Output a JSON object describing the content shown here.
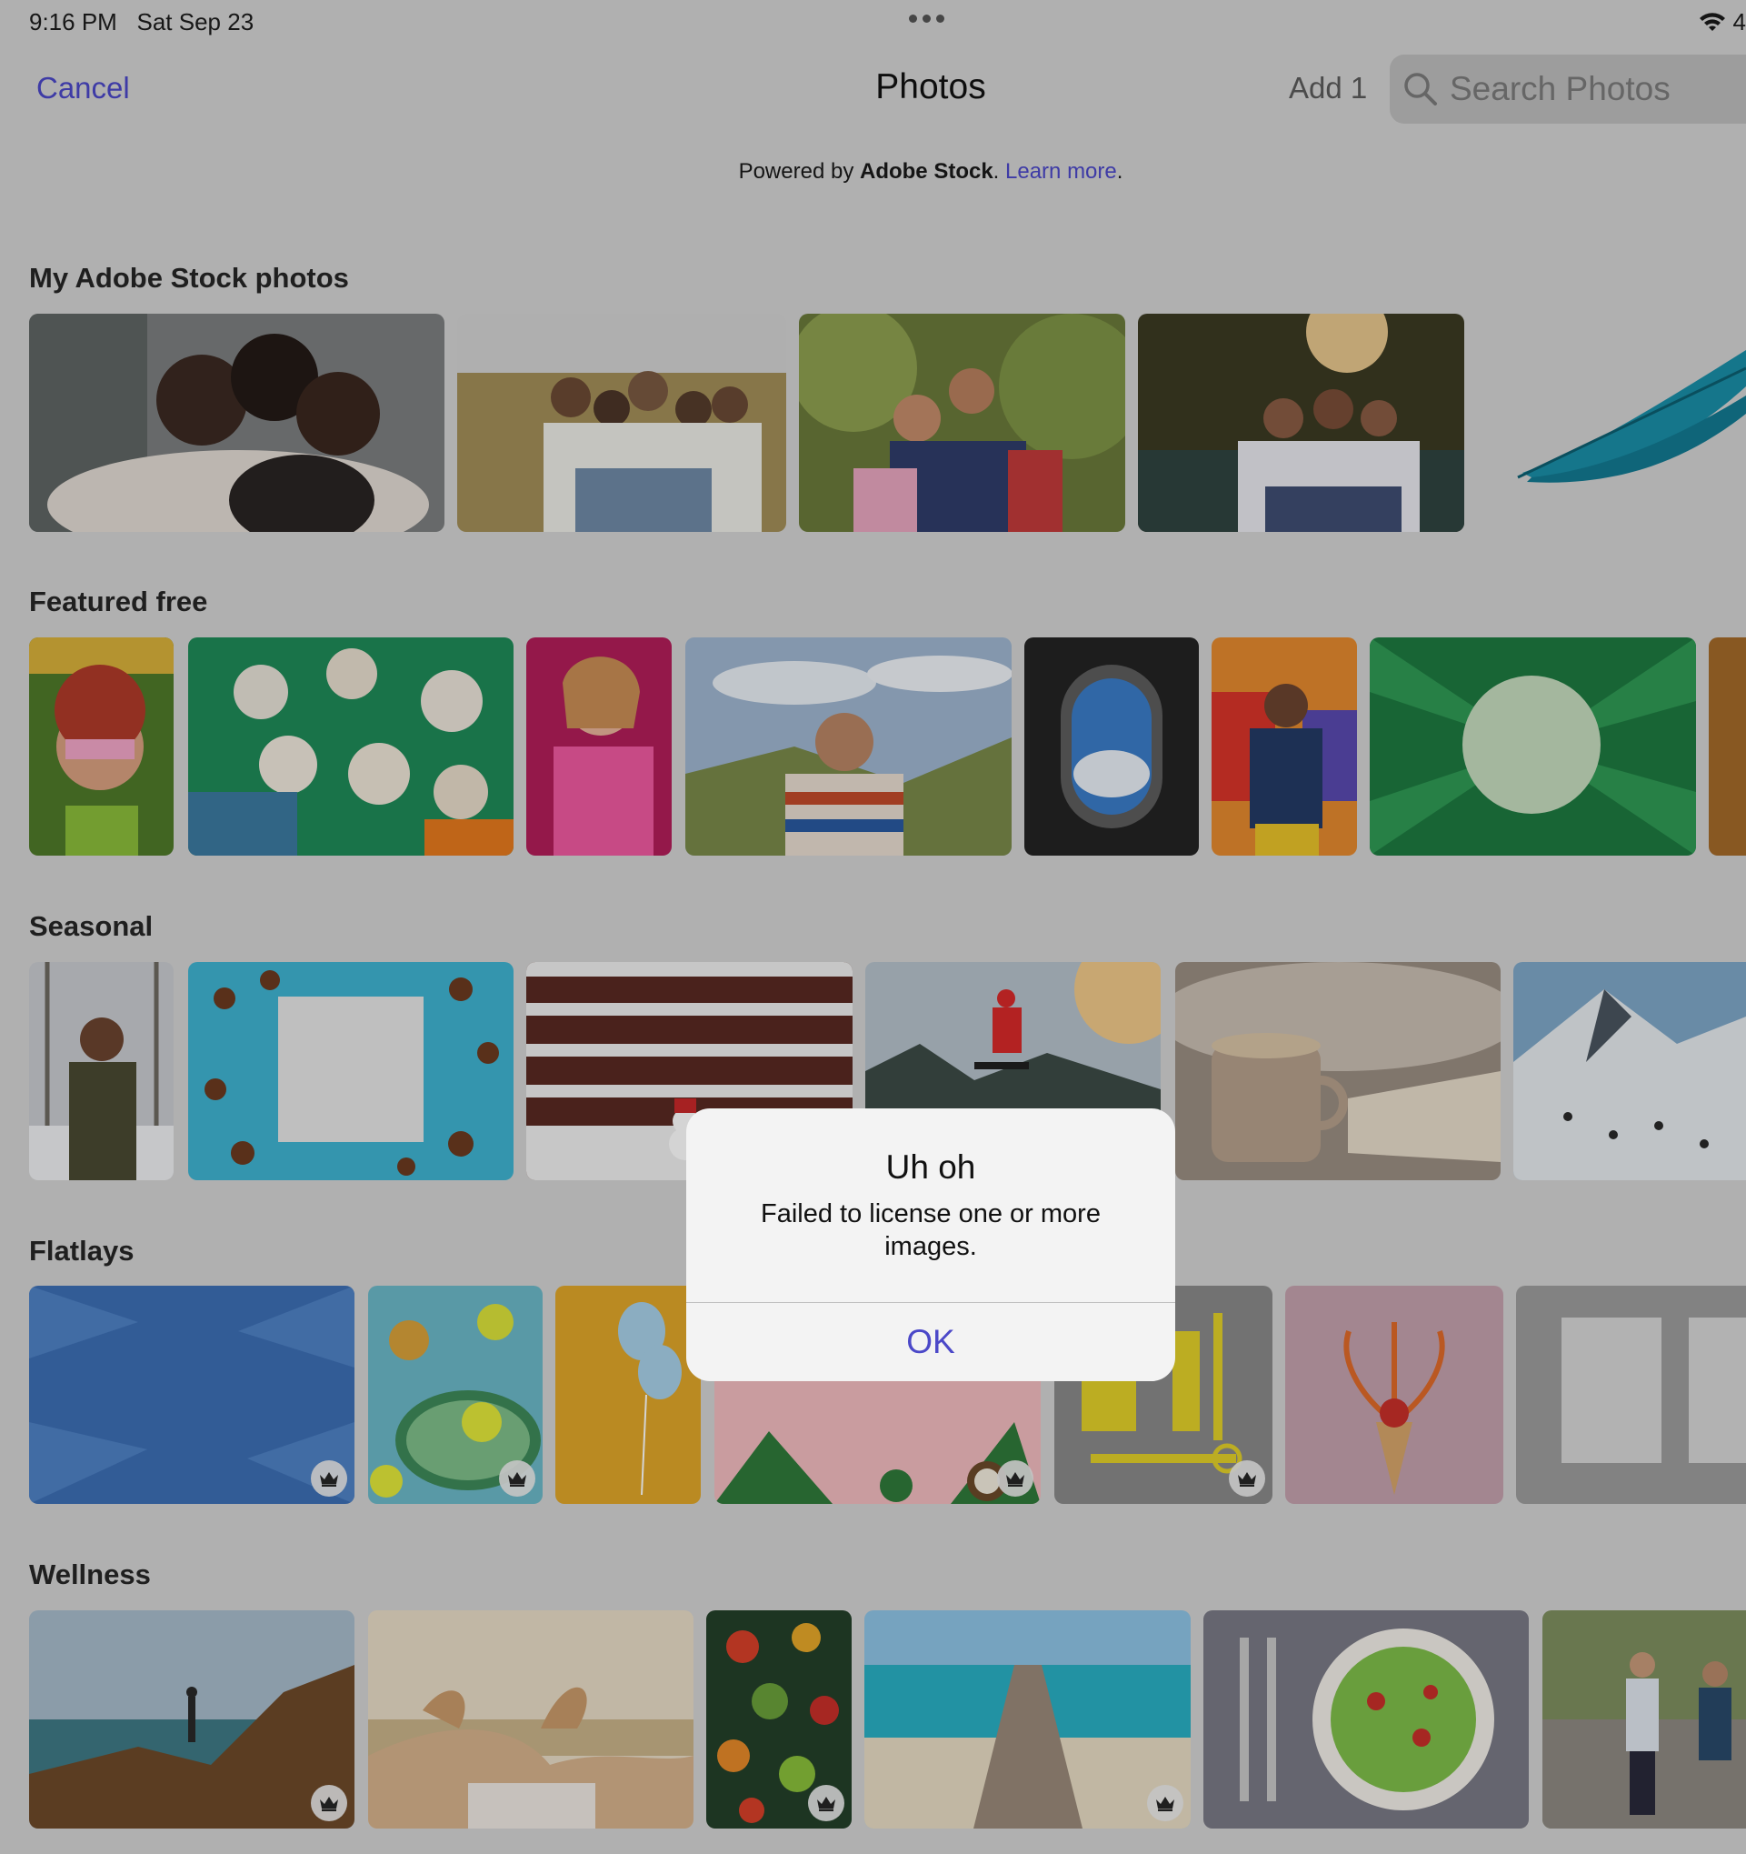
{
  "status": {
    "time": "9:16 PM",
    "date": "Sat Sep 23",
    "battery": "4"
  },
  "nav": {
    "cancel": "Cancel",
    "title": "Photos",
    "add": "Add 1"
  },
  "search": {
    "placeholder": "Search Photos"
  },
  "powered": {
    "prefix": "Powered by ",
    "brand": "Adobe Stock",
    "period1": ".",
    "link": "Learn more",
    "period2": "."
  },
  "sections": [
    {
      "title": "My Adobe Stock photos"
    },
    {
      "title": "Featured free"
    },
    {
      "title": "Seasonal"
    },
    {
      "title": "Flatlays"
    },
    {
      "title": "Wellness"
    }
  ],
  "alert": {
    "title": "Uh oh",
    "message": "Failed to license one or more images.",
    "ok": "OK"
  }
}
